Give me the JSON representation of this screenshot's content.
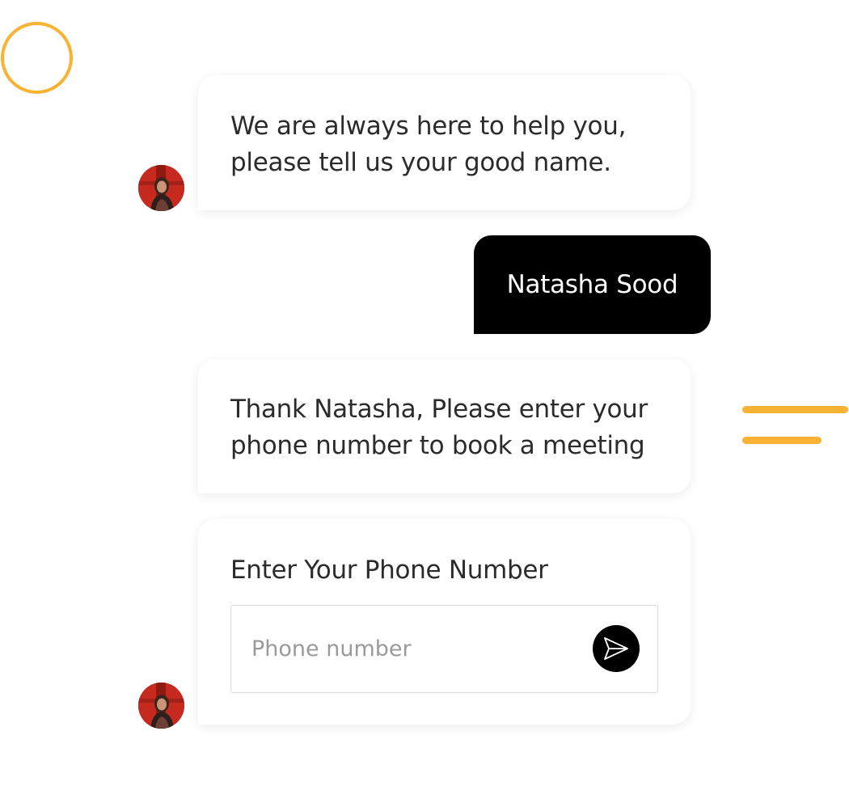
{
  "messages": {
    "bot_greeting": "We are always here to help you,\nplease tell us your good name.",
    "user_name": "Natasha Sood",
    "bot_thanks": "Thank Natasha, Please enter your\nphone number to book a meeting"
  },
  "phone_form": {
    "label": "Enter Your Phone Number",
    "placeholder": "Phone number",
    "send_icon": "send-icon"
  },
  "colors": {
    "accent": "#f9b233",
    "user_bubble": "#000000",
    "send_button": "#000000"
  }
}
